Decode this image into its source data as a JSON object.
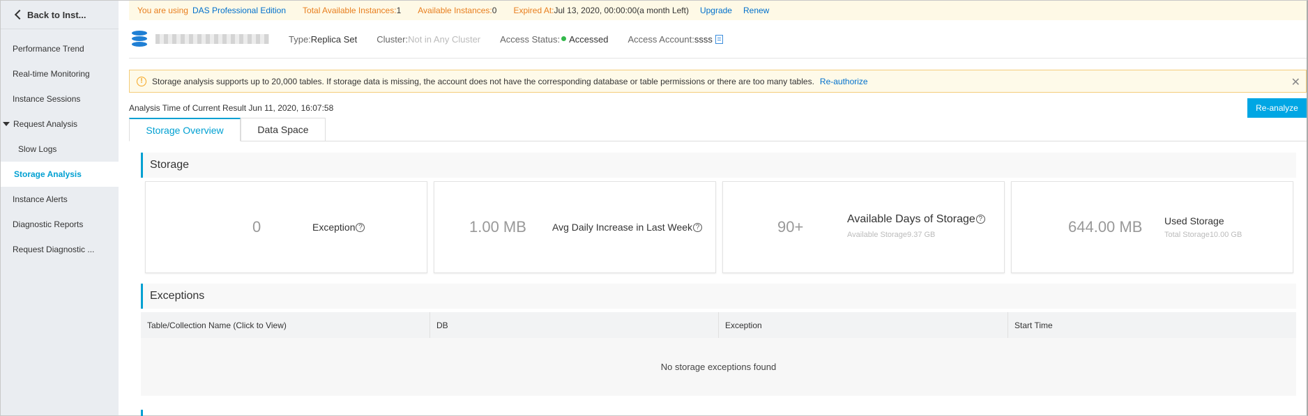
{
  "sidebar": {
    "back_label": "Back to Inst...",
    "items": [
      {
        "label": "Performance Trend"
      },
      {
        "label": "Real-time Monitoring"
      },
      {
        "label": "Instance Sessions"
      },
      {
        "label": "Request Analysis"
      },
      {
        "label": "Slow Logs"
      },
      {
        "label": "Storage Analysis"
      },
      {
        "label": "Instance Alerts"
      },
      {
        "label": "Diagnostic Reports"
      },
      {
        "label": "Request Diagnostic ..."
      }
    ]
  },
  "banner": {
    "using_label": "You are using",
    "edition": "DAS Professional Edition",
    "total_label": "Total Available Instances:",
    "total_value": "1",
    "available_label": "Available Instances:",
    "available_value": "0",
    "expired_label": "Expired At:",
    "expired_value": "Jul 13, 2020, 00:00:00(a month Left)",
    "upgrade": "Upgrade",
    "renew": "Renew"
  },
  "instance": {
    "type_label": "Type:",
    "type_value": "Replica Set",
    "cluster_label": "Cluster:",
    "cluster_value": "Not in Any Cluster",
    "status_label": "Access Status:",
    "status_value": "Accessed",
    "account_label": "Access Account:",
    "account_value": "ssss"
  },
  "notice": {
    "text": "Storage analysis supports up to 20,000 tables. If storage data is missing, the account does not have the corresponding database or table permissions or there are too many tables.",
    "link": "Re-authorize"
  },
  "analysis_time": "Analysis Time of Current Result Jun 11, 2020, 16:07:58",
  "reanalyze_label": "Re-analyze",
  "tabs": [
    {
      "label": "Storage Overview"
    },
    {
      "label": "Data Space"
    }
  ],
  "storage": {
    "title": "Storage",
    "cards": [
      {
        "value": "0",
        "name": "Exception"
      },
      {
        "value": "1.00 MB",
        "name": "Avg Daily Increase in Last Week"
      },
      {
        "value": "90+",
        "name": "Available Days of Storage",
        "sub": "Available Storage9.37 GB"
      },
      {
        "value": "644.00 MB",
        "name": "Used Storage",
        "sub": "Total Storage10.00 GB"
      }
    ]
  },
  "exceptions": {
    "title": "Exceptions",
    "columns": [
      "Table/Collection Name (Click to View)",
      "DB",
      "Exception",
      "Start Time"
    ],
    "empty_text": "No storage exceptions found"
  },
  "colors": {
    "accent": "#00a0d2",
    "banner_orange": "#e87e1e",
    "link_blue": "#0070cc",
    "status_green": "#33b84b"
  }
}
